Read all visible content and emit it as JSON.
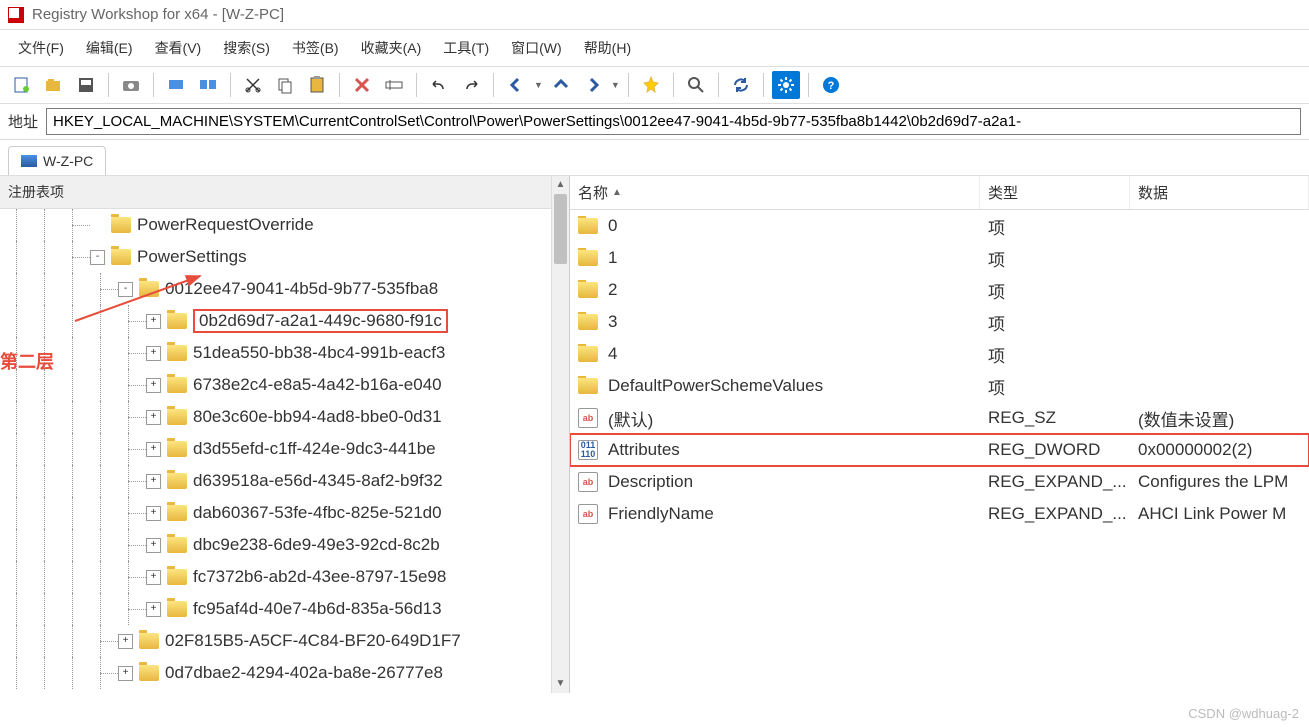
{
  "window": {
    "title": "Registry Workshop for x64 - [W-Z-PC]"
  },
  "menus": {
    "file": "文件(F)",
    "edit": "编辑(E)",
    "view": "查看(V)",
    "search": "搜索(S)",
    "bookmarks": "书签(B)",
    "favorites": "收藏夹(A)",
    "tools": "工具(T)",
    "window": "窗口(W)",
    "help": "帮助(H)"
  },
  "address": {
    "label": "地址",
    "value": "HKEY_LOCAL_MACHINE\\SYSTEM\\CurrentControlSet\\Control\\Power\\PowerSettings\\0012ee47-9041-4b5d-9b77-535fba8b1442\\0b2d69d7-a2a1-"
  },
  "tabs": {
    "active": "W-Z-PC"
  },
  "leftPanel": {
    "header": "注册表项",
    "annotation": "第二层",
    "items": [
      {
        "label": "PowerRequestOverride",
        "depth": 3,
        "exp": null
      },
      {
        "label": "PowerSettings",
        "depth": 3,
        "exp": "-"
      },
      {
        "label": "0012ee47-9041-4b5d-9b77-535fba8",
        "depth": 4,
        "exp": "-"
      },
      {
        "label": "0b2d69d7-a2a1-449c-9680-f91c",
        "depth": 5,
        "exp": "+",
        "selected": true
      },
      {
        "label": "51dea550-bb38-4bc4-991b-eacf3",
        "depth": 5,
        "exp": "+"
      },
      {
        "label": "6738e2c4-e8a5-4a42-b16a-e040",
        "depth": 5,
        "exp": "+"
      },
      {
        "label": "80e3c60e-bb94-4ad8-bbe0-0d31",
        "depth": 5,
        "exp": "+"
      },
      {
        "label": "d3d55efd-c1ff-424e-9dc3-441be",
        "depth": 5,
        "exp": "+"
      },
      {
        "label": "d639518a-e56d-4345-8af2-b9f32",
        "depth": 5,
        "exp": "+"
      },
      {
        "label": "dab60367-53fe-4fbc-825e-521d0",
        "depth": 5,
        "exp": "+"
      },
      {
        "label": "dbc9e238-6de9-49e3-92cd-8c2b",
        "depth": 5,
        "exp": "+"
      },
      {
        "label": "fc7372b6-ab2d-43ee-8797-15e98",
        "depth": 5,
        "exp": "+"
      },
      {
        "label": "fc95af4d-40e7-4b6d-835a-56d13",
        "depth": 5,
        "exp": "+"
      },
      {
        "label": "02F815B5-A5CF-4C84-BF20-649D1F7",
        "depth": 4,
        "exp": "+"
      },
      {
        "label": "0d7dbae2-4294-402a-ba8e-26777e8",
        "depth": 4,
        "exp": "+"
      }
    ]
  },
  "rightPanel": {
    "cols": {
      "name": "名称",
      "type": "类型",
      "data": "数据"
    },
    "rows": [
      {
        "icon": "folder",
        "name": "0",
        "type": "项",
        "data": ""
      },
      {
        "icon": "folder",
        "name": "1",
        "type": "项",
        "data": ""
      },
      {
        "icon": "folder",
        "name": "2",
        "type": "项",
        "data": ""
      },
      {
        "icon": "folder",
        "name": "3",
        "type": "项",
        "data": ""
      },
      {
        "icon": "folder",
        "name": "4",
        "type": "项",
        "data": ""
      },
      {
        "icon": "folder",
        "name": "DefaultPowerSchemeValues",
        "type": "项",
        "data": ""
      },
      {
        "icon": "str",
        "name": "(默认)",
        "type": "REG_SZ",
        "data": "(数值未设置)"
      },
      {
        "icon": "bin",
        "name": "Attributes",
        "type": "REG_DWORD",
        "data": "0x00000002(2)",
        "hl": true
      },
      {
        "icon": "str",
        "name": "Description",
        "type": "REG_EXPAND_...",
        "data": "Configures the LPM"
      },
      {
        "icon": "str",
        "name": "FriendlyName",
        "type": "REG_EXPAND_...",
        "data": "AHCI Link Power M"
      }
    ]
  },
  "watermark": "CSDN @wdhuag-2"
}
